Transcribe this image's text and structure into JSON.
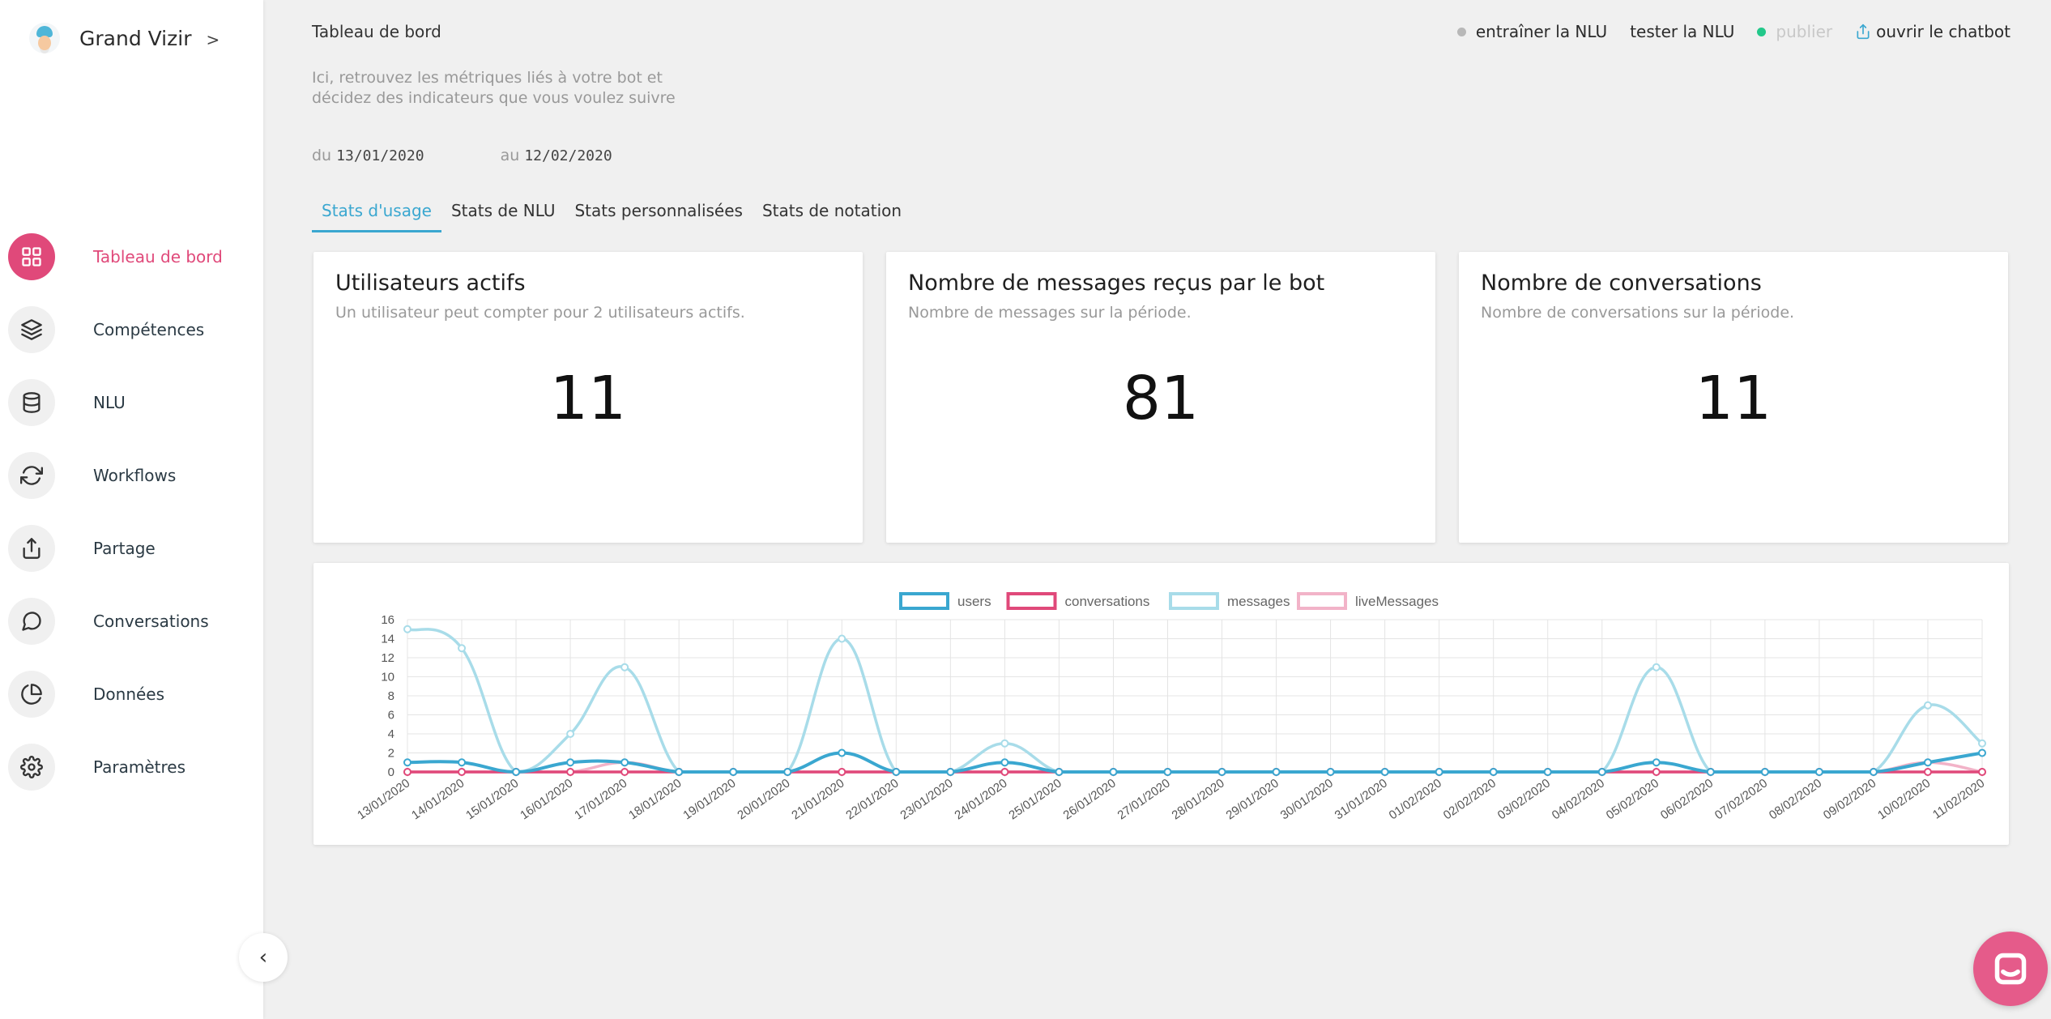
{
  "brand": {
    "name": "Grand Vizir",
    "chevron": ">"
  },
  "sidebar": {
    "items": [
      {
        "label": "Tableau de bord",
        "icon": "dashboard-icon",
        "active": true
      },
      {
        "label": "Compétences",
        "icon": "layers-icon"
      },
      {
        "label": "NLU",
        "icon": "database-icon"
      },
      {
        "label": "Workflows",
        "icon": "refresh-icon"
      },
      {
        "label": "Partage",
        "icon": "upload-icon"
      },
      {
        "label": "Conversations",
        "icon": "chat-icon"
      },
      {
        "label": "Données",
        "icon": "pie-chart-icon"
      },
      {
        "label": "Paramètres",
        "icon": "gear-icon"
      }
    ],
    "collapse_glyph": "‹"
  },
  "header": {
    "breadcrumb": "Tableau de bord",
    "description": "Ici, retrouvez les métriques liés à votre bot et décidez des indicateurs que vous voulez suivre",
    "date_from_label": "du",
    "date_from": "13/01/2020",
    "date_to_label": "au",
    "date_to": "12/02/2020"
  },
  "actions": {
    "train": "entraîner la NLU",
    "test": "tester la NLU",
    "publish": "publier",
    "open": "ouvrir le chatbot"
  },
  "tabs": [
    {
      "label": "Stats d'usage",
      "active": true
    },
    {
      "label": "Stats de NLU"
    },
    {
      "label": "Stats personnalisées"
    },
    {
      "label": "Stats de notation"
    }
  ],
  "cards": [
    {
      "title": "Utilisateurs actifs",
      "subtitle": "Un utilisateur peut compter pour 2 utilisateurs actifs.",
      "value": "11"
    },
    {
      "title": "Nombre de messages reçus par le bot",
      "subtitle": "Nombre de messages sur la période.",
      "value": "81"
    },
    {
      "title": "Nombre de conversations",
      "subtitle": "Nombre de conversations sur la période.",
      "value": "11"
    }
  ],
  "colors": {
    "accent": "#e0497a",
    "tab_active": "#3aa7d0",
    "users": "#3aa7d0",
    "conversations": "#e0497a",
    "messages": "#a8dce9",
    "liveMessages": "#f2b3c8"
  },
  "chart_data": {
    "type": "line",
    "x": [
      "13/01/2020",
      "14/01/2020",
      "15/01/2020",
      "16/01/2020",
      "17/01/2020",
      "18/01/2020",
      "19/01/2020",
      "20/01/2020",
      "21/01/2020",
      "22/01/2020",
      "23/01/2020",
      "24/01/2020",
      "25/01/2020",
      "26/01/2020",
      "27/01/2020",
      "28/01/2020",
      "29/01/2020",
      "30/01/2020",
      "31/01/2020",
      "01/02/2020",
      "02/02/2020",
      "03/02/2020",
      "04/02/2020",
      "05/02/2020",
      "06/02/2020",
      "07/02/2020",
      "08/02/2020",
      "09/02/2020",
      "10/02/2020",
      "11/02/2020"
    ],
    "yticks": [
      0,
      2,
      4,
      6,
      8,
      10,
      12,
      14,
      16
    ],
    "ylim": [
      0,
      16
    ],
    "legend": "top",
    "grid": true,
    "series": [
      {
        "name": "users",
        "color": "#3aa7d0",
        "values": [
          1,
          1,
          0,
          1,
          1,
          0,
          0,
          0,
          2,
          0,
          0,
          1,
          0,
          0,
          0,
          0,
          0,
          0,
          0,
          0,
          0,
          0,
          0,
          1,
          0,
          0,
          0,
          0,
          1,
          2
        ]
      },
      {
        "name": "conversations",
        "color": "#e0497a",
        "values": [
          0,
          0,
          0,
          0,
          0,
          0,
          0,
          0,
          0,
          0,
          0,
          0,
          0,
          0,
          0,
          0,
          0,
          0,
          0,
          0,
          0,
          0,
          0,
          0,
          0,
          0,
          0,
          0,
          0,
          0
        ]
      },
      {
        "name": "messages",
        "color": "#a8dce9",
        "values": [
          15,
          13,
          0,
          4,
          11,
          0,
          0,
          0,
          14,
          0,
          0,
          3,
          0,
          0,
          0,
          0,
          0,
          0,
          0,
          0,
          0,
          0,
          0,
          11,
          0,
          0,
          0,
          0,
          7,
          3
        ]
      },
      {
        "name": "liveMessages",
        "color": "#f2b3c8",
        "values": [
          0,
          0,
          0,
          0,
          1,
          0,
          0,
          0,
          0,
          0,
          0,
          0,
          0,
          0,
          0,
          0,
          0,
          0,
          0,
          0,
          0,
          0,
          0,
          0,
          0,
          0,
          0,
          0,
          1,
          0
        ]
      }
    ]
  }
}
